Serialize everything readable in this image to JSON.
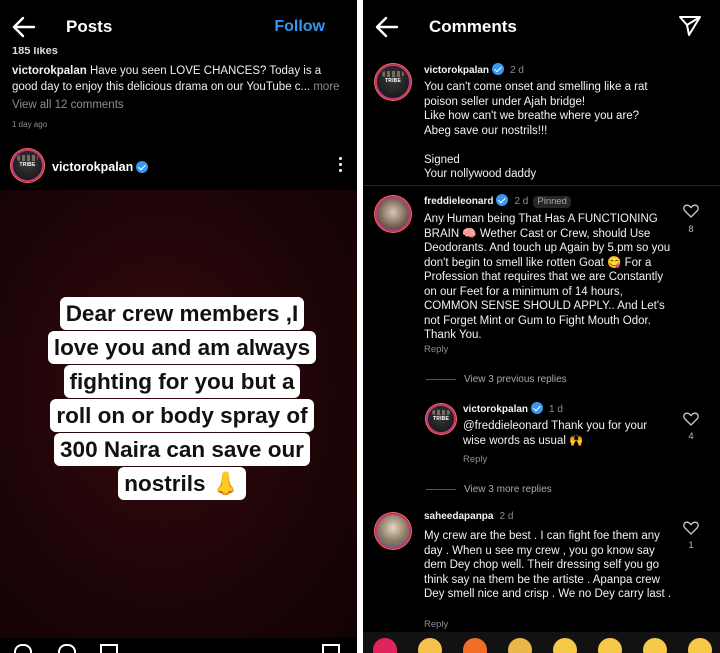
{
  "left": {
    "title": "Posts",
    "follow": "Follow",
    "likes_partial": "185 likes",
    "caption_user": "victorokpalan",
    "caption_text": "Have you seen LOVE CHANCES? Today is a good day to enjoy this delicious drama on our YouTube c...",
    "caption_more": "more",
    "view_all": "View all 12 comments",
    "time": "1 day ago",
    "post_user": "victorokpalan",
    "quote_lines": [
      "Dear crew members ,I",
      "love you and am always",
      "fighting for you but a",
      "roll on or body spray of",
      "300 Naira can save our",
      "nostrils 👃"
    ]
  },
  "right": {
    "title": "Comments",
    "comments": [
      {
        "user": "victorokpalan",
        "time": "2 d",
        "text": "You can't come onset and smelling like a rat poison seller under Ajah bridge!\nLike how can't we breathe where you are?\nAbeg save our nostrils!!!\n\nSigned\nYour nollywood daddy"
      },
      {
        "user": "freddieleonard",
        "time": "2 d",
        "pinned": "Pinned",
        "text": "Any Human being That Has A FUNCTIONING BRAIN 🧠 Wether Cast or Crew, should Use Deodorants. And touch up Again by 5.pm so you don't begin to smell like rotten Goat 😋 For a Profession that requires that we are Constantly on our Feet for a minimum of 14 hours, COMMON SENSE SHOULD APPLY.. And Let's not Forget Mint or Gum to Fight Mouth Odor.  Thank You.",
        "reply": "Reply",
        "likes": "8"
      },
      {
        "user": "victorokpalan",
        "time": "1 d",
        "text": "@freddieleonard Thank you for your wise words as usual 🙌",
        "reply": "Reply",
        "likes": "4"
      },
      {
        "user": "saheedapanpa",
        "time": "2 d",
        "text": "My crew are the best . I can fight foe them any day .  When u see my crew , you go know say dem Dey chop well.  Their dressing self you go think say na them be the artiste .  Apanpa crew Dey smell nice and crisp .  We no Dey carry last .",
        "reply": "Reply",
        "likes": "1"
      }
    ],
    "view_previous": "View 3 previous replies",
    "view_more": "View 3 more replies",
    "emoji_bar": [
      "heart",
      "clap",
      "fire",
      "party",
      "crying-laughing",
      "heart-eyes",
      "astonished",
      "laughing"
    ]
  },
  "colors": {
    "background": "#000000",
    "accent": "#3797f0",
    "muted": "#8e8e8e",
    "verified": "#3897f0"
  }
}
